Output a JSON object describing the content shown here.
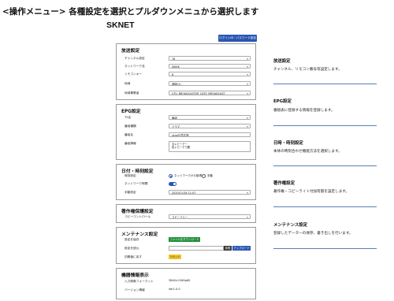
{
  "page": {
    "heading": "<操作メニュー> 各種設定を選択とプルダウンメニュから選択します",
    "brand": "SKNET",
    "login_button": "ログインID・パスワード設定"
  },
  "broadcast": {
    "title": "放送設定",
    "rows": [
      {
        "label": "チャンネル設定",
        "value": "78"
      },
      {
        "label": "ネットワーク名",
        "value": "SKJKK"
      },
      {
        "label": "リモコンキー",
        "value": "8"
      },
      {
        "label": "地域",
        "value": "静岡(1)"
      },
      {
        "label": "地域事業者",
        "value": "(ITU_BROADCASTER_CATV_BROADCAST"
      }
    ]
  },
  "epg": {
    "title": "EPG設定",
    "rows": [
      {
        "label": "TS名",
        "value": "番組"
      },
      {
        "label": "番組種類",
        "value": "ドラマ"
      },
      {
        "label": "番組名",
        "value": "skne社員名簿"
      },
      {
        "label": "番組情報",
        "value": "当レビーデー"
      }
    ],
    "program_info": "色レビーデで殿"
  },
  "datetime": {
    "title": "日付・時刻設定",
    "time_setting_label": "時刻設定",
    "radio_network": "ネットワークから取得",
    "radio_manual": "手動",
    "ntp_label": "ネットワーク時間",
    "manual_label": "手動設定",
    "manual_value": "2020/11/26 11:07"
  },
  "copyright": {
    "title": "著作権保護設定",
    "label": "コピーコントロール",
    "value": "コピーフリー"
  },
  "maintenance": {
    "title": "メンテナンス設定",
    "save_label": "設定を保存",
    "save_button": "ファイルをダウンロード",
    "load_label": "設定を読込",
    "browse_button": "参照",
    "upload_button": "アップロード",
    "reset_label": "初期値に戻す",
    "reset_button": "リセット"
  },
  "device": {
    "title": "機器情報表示",
    "rows": [
      {
        "label": "入力映像フォーマット",
        "value": "3840×2160p60"
      },
      {
        "label": "バージョン情報",
        "value": "Ver1.0.0"
      }
    ]
  },
  "descriptions": [
    {
      "title": "放送設定",
      "text": "チャンネル、リモコン番号等設定します。"
    },
    {
      "title": "EPG設定",
      "text": "番組表に登録する情報を登録します。"
    },
    {
      "title": "日時・時刻設定",
      "text": "本体の時刻合わせ機能方法を選択します。"
    },
    {
      "title": "著作権設定",
      "text": "著作権・コピーライト付加有無を設定します。"
    },
    {
      "title": "メンテナンス設定",
      "text": "登録したデーターの保存、書き出しを行います。"
    }
  ],
  "colors": {
    "accent": "#2b56b3",
    "green": "#1f8f3a",
    "dark_button": "#333333",
    "yellow": "#f3c623",
    "panel_border": "#9a9a9a",
    "divider": "#5a7fb8"
  },
  "icons": {
    "chevron": "chevron-down-icon",
    "radio": "radio-icon",
    "toggle": "toggle-switch"
  }
}
